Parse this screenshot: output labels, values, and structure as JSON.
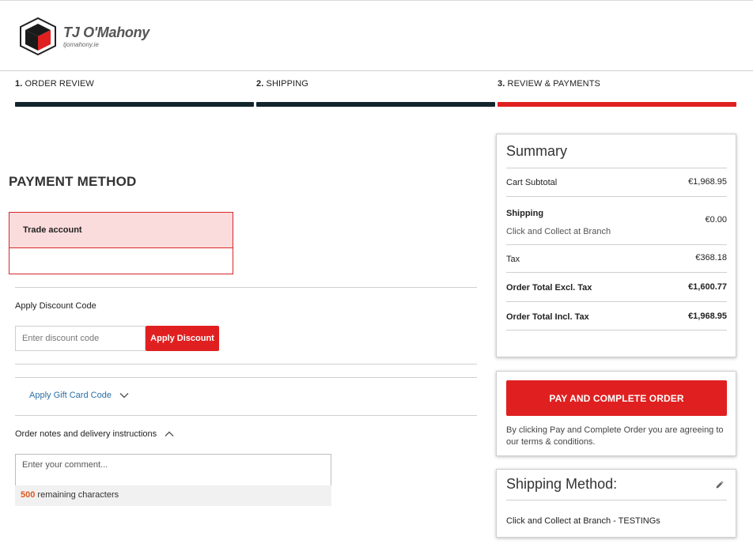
{
  "brand": {
    "name": "TJ O'Mahony",
    "url": "tjomahony.ie",
    "colors": {
      "accent": "#e02020",
      "dark": "#13252c",
      "selected_bg": "#fbdcdd"
    }
  },
  "steps": [
    {
      "number": "1.",
      "label": "ORDER REVIEW",
      "state": "complete",
      "color": "#13252c"
    },
    {
      "number": "2.",
      "label": "SHIPPING",
      "state": "complete",
      "color": "#13252c"
    },
    {
      "number": "3.",
      "label": "REVIEW & PAYMENTS",
      "state": "active",
      "color": "#e02020"
    }
  ],
  "payment": {
    "title": "PAYMENT METHOD",
    "selected_option": "Trade account"
  },
  "discount": {
    "label": "Apply Discount Code",
    "placeholder": "Enter discount code",
    "button": "Apply Discount"
  },
  "gift_card": {
    "label": "Apply Gift Card Code",
    "icon": "chevron-down-icon"
  },
  "notes": {
    "label": "Order notes and delivery instructions",
    "icon": "chevron-up-icon",
    "placeholder": "Enter your comment...",
    "remaining_count": "500",
    "remaining_text": "remaining characters"
  },
  "summary": {
    "title": "Summary",
    "cart_subtotal": {
      "label": "Cart Subtotal",
      "value": "€1,968.95"
    },
    "shipping": {
      "label": "Shipping",
      "method": "Click and Collect at Branch",
      "value": "€0.00"
    },
    "tax": {
      "label": "Tax",
      "value": "€368.18"
    },
    "total_excl": {
      "label": "Order Total Excl. Tax",
      "value": "€1,600.77"
    },
    "total_incl": {
      "label": "Order Total Incl. Tax",
      "value": "€1,968.95"
    }
  },
  "pay": {
    "button": "PAY AND COMPLETE ORDER",
    "note": "By clicking Pay and Complete Order you are agreeing to our terms & conditions."
  },
  "shipping_method": {
    "title": "Shipping Method:",
    "value": "Click and Collect at Branch - TESTINGs",
    "icon": "pencil-icon"
  }
}
